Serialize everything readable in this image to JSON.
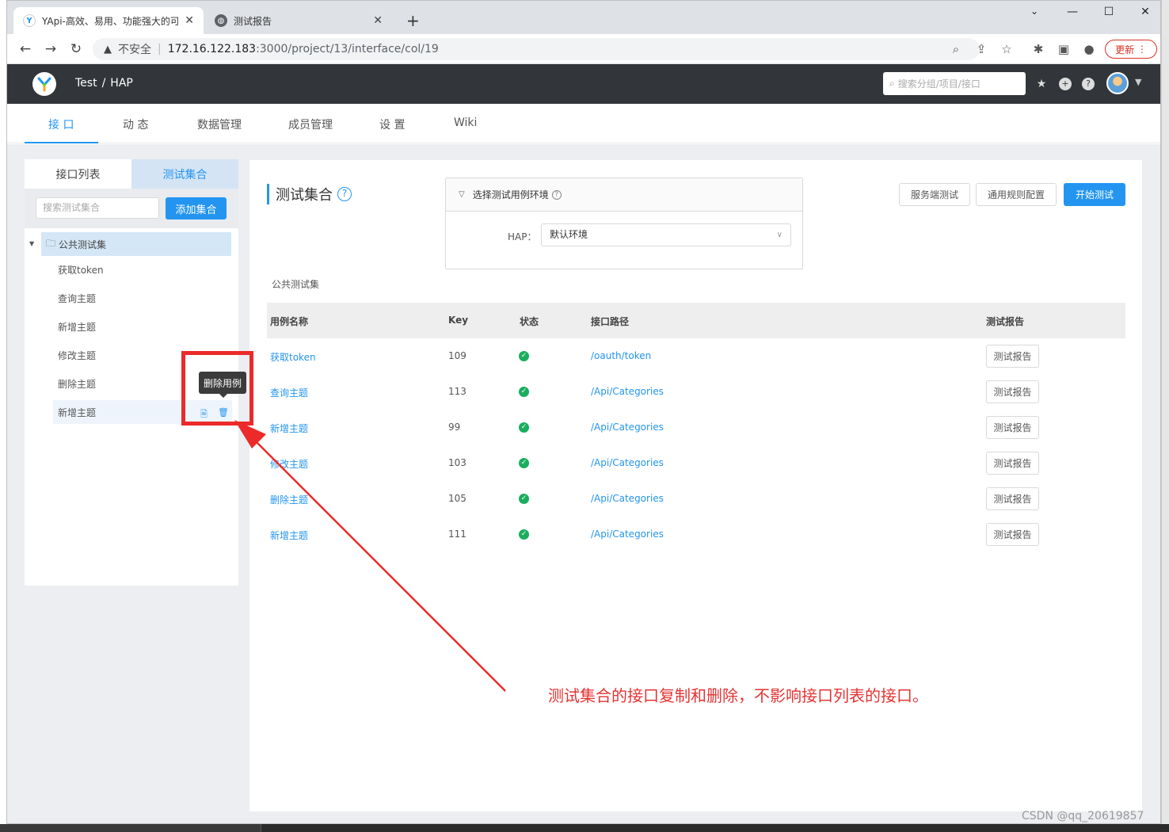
{
  "browser": {
    "tabs": [
      {
        "title": "YApi-高效、易用、功能强大的可"
      },
      {
        "title": "测试报告"
      }
    ],
    "security_label": "不安全",
    "url_host": "172.16.122.183",
    "url_rest": ":3000/project/13/interface/col/19",
    "update_label": "更新"
  },
  "header": {
    "crumb_group": "Test",
    "crumb_project": "HAP",
    "search_placeholder": "搜索分组/项目/接口"
  },
  "subnav": {
    "tabs": [
      "接 口",
      "动 态",
      "数据管理",
      "成员管理",
      "设 置",
      "Wiki"
    ]
  },
  "sidebar": {
    "tab_list": "接口列表",
    "tab_collection": "测试集合",
    "search_placeholder": "搜索测试集合",
    "add_label": "添加集合",
    "root": "公共测试集",
    "items": [
      "获取token",
      "查询主题",
      "新增主题",
      "修改主题",
      "删除主题",
      "新增主题"
    ],
    "tooltip": "删除用例"
  },
  "main": {
    "title": "测试集合",
    "env_header": "选择测试用例环境",
    "env_label": "HAP：",
    "env_value": "默认环境",
    "btn_server": "服务端测试",
    "btn_rules": "通用规则配置",
    "btn_start": "开始测试",
    "set_name": "公共测试集",
    "columns": [
      "用例名称",
      "Key",
      "状态",
      "接口路径",
      "测试报告"
    ],
    "rows": [
      {
        "name": "获取token",
        "key": "109",
        "path": "/oauth/token",
        "report": "测试报告"
      },
      {
        "name": "查询主题",
        "key": "113",
        "path": "/Api/Categories",
        "report": "测试报告"
      },
      {
        "name": "新增主题",
        "key": "99",
        "path": "/Api/Categories",
        "report": "测试报告"
      },
      {
        "name": "修改主题",
        "key": "103",
        "path": "/Api/Categories",
        "report": "测试报告"
      },
      {
        "name": "删除主题",
        "key": "105",
        "path": "/Api/Categories",
        "report": "测试报告"
      },
      {
        "name": "新增主题",
        "key": "111",
        "path": "/Api/Categories",
        "report": "测试报告"
      }
    ]
  },
  "annotation": {
    "text": "测试集合的接口复制和删除，不影响接口列表的接口。",
    "color": "#e53333"
  },
  "watermark": "CSDN @qq_20619857",
  "colors": {
    "accent": "#2395f1",
    "header": "#32363a",
    "success": "#1aad5e"
  }
}
